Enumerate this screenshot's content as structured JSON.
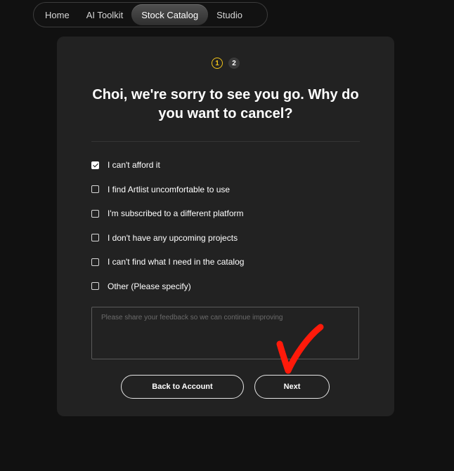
{
  "nav": {
    "items": [
      {
        "label": "Home",
        "active": false
      },
      {
        "label": "AI Toolkit",
        "active": false
      },
      {
        "label": "Stock Catalog",
        "active": true
      },
      {
        "label": "Studio",
        "active": false
      }
    ]
  },
  "steps": {
    "current": "1",
    "next": "2"
  },
  "dialog": {
    "title": "Choi, we're sorry to see you go. Why do you want to cancel?",
    "options": [
      {
        "label": "I can't afford it",
        "checked": true
      },
      {
        "label": "I find Artlist uncomfortable to use",
        "checked": false
      },
      {
        "label": "I'm subscribed to a different platform",
        "checked": false
      },
      {
        "label": "I don't have any upcoming projects",
        "checked": false
      },
      {
        "label": "I can't find what I need in the catalog",
        "checked": false
      },
      {
        "label": "Other (Please specify)",
        "checked": false
      }
    ],
    "feedback_placeholder": "Please share your feedback so we can continue improving",
    "feedback_value": "",
    "back_label": "Back to Account",
    "next_label": "Next"
  },
  "colors": {
    "background": "#111111",
    "card": "#222222",
    "step_accent": "#f2c418",
    "annotation": "#ff1a0a"
  },
  "icons": {
    "annotation": "red-checkmark-annotation-icon",
    "checkbox_checked": "checkbox-checked-icon"
  }
}
